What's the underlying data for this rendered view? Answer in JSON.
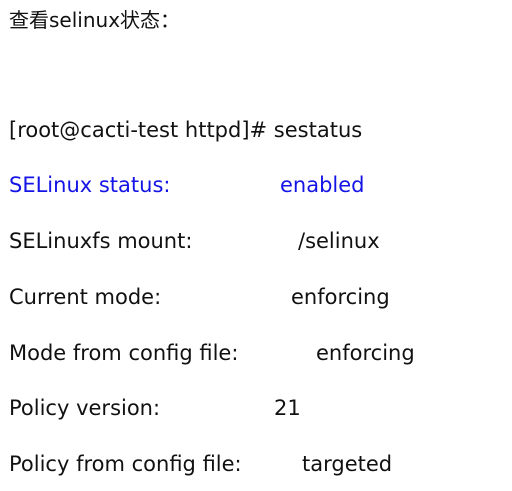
{
  "heading": "查看selinux状态：",
  "command": "[root@cacti-test httpd]# sestatus",
  "status_lines": [
    {
      "label": "SELinux status:",
      "value": "enabled"
    },
    {
      "label": "SELinuxfs mount:",
      "value": "/selinux"
    },
    {
      "label": "Current mode:",
      "value": "enforcing"
    },
    {
      "label": "Mode from config file:",
      "value": "enforcing"
    },
    {
      "label": "Policy version:",
      "value": "21"
    },
    {
      "label": "Policy from config file:",
      "value": "targeted"
    }
  ],
  "colors": {
    "highlight_text": "#1414e6",
    "body_text": "#111111"
  }
}
